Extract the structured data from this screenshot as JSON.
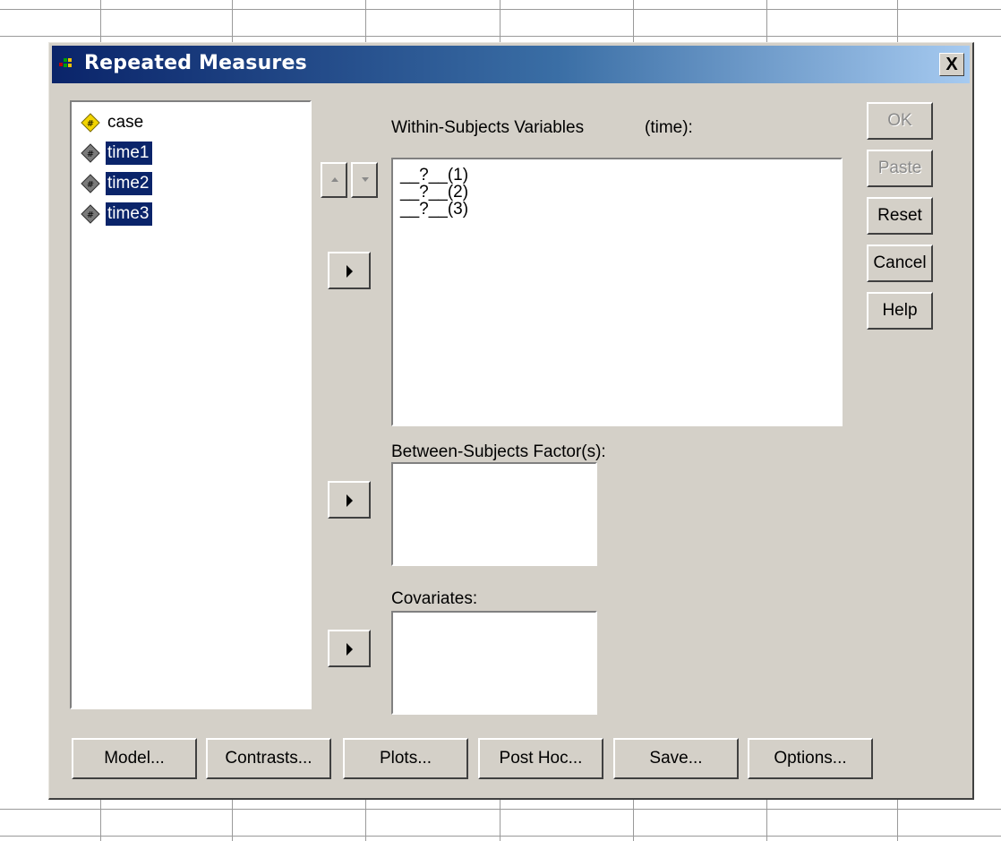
{
  "dialog": {
    "title": "Repeated Measures",
    "close_label": "X"
  },
  "variables": [
    {
      "name": "case",
      "selected": false,
      "icon": "diamond-scale-icon",
      "color": "#f2d400"
    },
    {
      "name": "time1",
      "selected": true,
      "icon": "diamond-scale-icon",
      "color": "#6a6a6a"
    },
    {
      "name": "time2",
      "selected": true,
      "icon": "diamond-scale-icon",
      "color": "#6a6a6a"
    },
    {
      "name": "time3",
      "selected": true,
      "icon": "diamond-scale-icon",
      "color": "#6a6a6a"
    }
  ],
  "within": {
    "label": "Within-Subjects Variables",
    "factor": "(time):",
    "items": [
      "__?__(1)",
      "__?__(2)",
      "__?__(3)"
    ]
  },
  "between": {
    "label": "Between-Subjects Factor(s):"
  },
  "covariates": {
    "label": "Covariates:"
  },
  "side_buttons": {
    "ok": "OK",
    "paste": "Paste",
    "reset": "Reset",
    "cancel": "Cancel",
    "help": "Help"
  },
  "bottom_buttons": {
    "model": "Model...",
    "contrasts": "Contrasts...",
    "plots": "Plots...",
    "post_hoc": "Post Hoc...",
    "save": "Save...",
    "options": "Options..."
  },
  "colors": {
    "title_bar": "#0a246a",
    "selection": "#0a246a",
    "dialog_face": "#d4d0c8"
  }
}
